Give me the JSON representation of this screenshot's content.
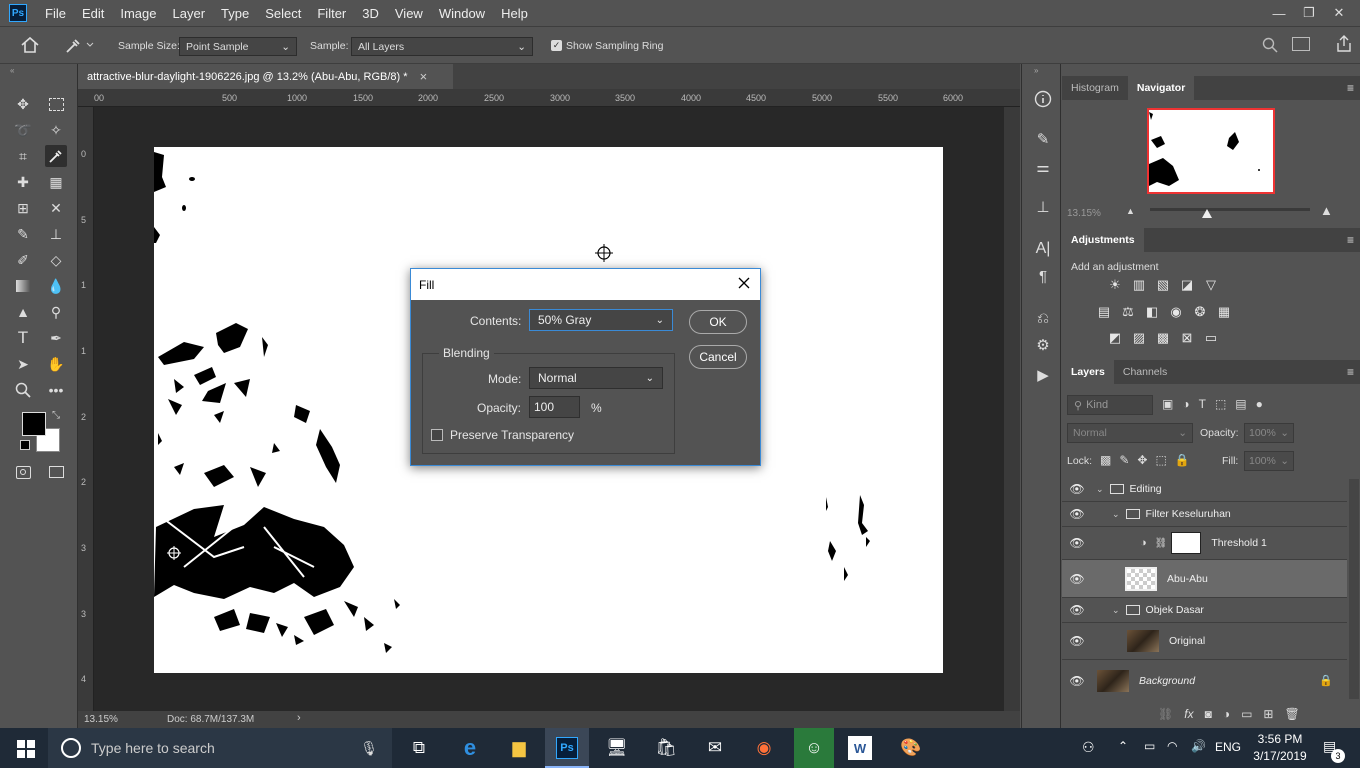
{
  "menubar": {
    "logo": "Ps",
    "items": [
      "File",
      "Edit",
      "Image",
      "Layer",
      "Type",
      "Select",
      "Filter",
      "3D",
      "View",
      "Window",
      "Help"
    ],
    "minimize": "—",
    "restore": "❐",
    "close": "✕"
  },
  "options": {
    "sample_size_label": "Sample Size:",
    "sample_size_value": "Point Sample",
    "sample_label": "Sample:",
    "sample_value": "All Layers",
    "show_ring_label": "Show Sampling Ring"
  },
  "document": {
    "tab_title": "attractive-blur-daylight-1906226.jpg @ 13.2% (Abu-Abu, RGB/8) *",
    "close": "×",
    "ruler_h": [
      "00",
      "500",
      "1000",
      "1500",
      "2000",
      "2500",
      "3000",
      "3500",
      "4000",
      "4500",
      "5000",
      "5500",
      "6000"
    ],
    "ruler_v": [
      "0",
      "5",
      "1",
      "1",
      "2",
      "2",
      "3",
      "3",
      "4"
    ],
    "zoom_status": "13.15%",
    "doc_status": "Doc: 68.7M/137.3M"
  },
  "panels": {
    "histogram_tab": "Histogram",
    "navigator_tab": "Navigator",
    "nav_zoom": "13.15%",
    "adjustments_tab": "Adjustments",
    "add_adjustment": "Add an adjustment",
    "layers_tab": "Layers",
    "channels_tab": "Channels",
    "kind_placeholder": "Kind",
    "blend_mode": "Normal",
    "opacity_label": "Opacity:",
    "opacity_value": "100%",
    "lock_label": "Lock:",
    "fill_label": "Fill:",
    "fill_value": "100%",
    "layers": [
      {
        "name": "Editing",
        "type": "group"
      },
      {
        "name": "Filter Keseluruhan",
        "type": "group"
      },
      {
        "name": "Threshold 1",
        "type": "adjustment"
      },
      {
        "name": "Abu-Abu",
        "type": "layer"
      },
      {
        "name": "Objek Dasar",
        "type": "group"
      },
      {
        "name": "Original",
        "type": "layer"
      },
      {
        "name": "Background",
        "type": "background"
      }
    ]
  },
  "dialog": {
    "title": "Fill",
    "contents_label": "Contents:",
    "contents_value": "50% Gray",
    "blending_label": "Blending",
    "mode_label": "Mode:",
    "mode_value": "Normal",
    "opacity_label": "Opacity:",
    "opacity_value": "100",
    "percent": "%",
    "preserve_label": "Preserve Transparency",
    "ok_label": "OK",
    "cancel_label": "Cancel"
  },
  "taskbar": {
    "search_placeholder": "Type here to search",
    "language": "ENG",
    "time": "3:56 PM",
    "date": "3/17/2019",
    "notification_count": "3"
  }
}
